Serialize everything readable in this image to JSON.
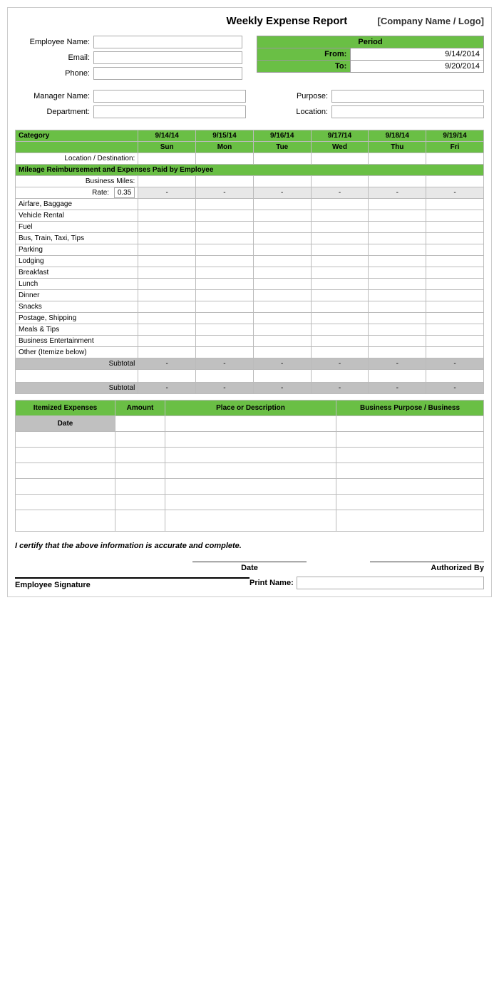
{
  "title": "Weekly Expense Report",
  "company": "[Company Name / Logo]",
  "fields": {
    "employee_name_label": "Employee Name:",
    "email_label": "Email:",
    "phone_label": "Phone:",
    "manager_name_label": "Manager Name:",
    "department_label": "Department:",
    "purpose_label": "Purpose:",
    "location_label": "Location:"
  },
  "period": {
    "header": "Period",
    "from_label": "From:",
    "from_value": "9/14/2014",
    "to_label": "To:",
    "to_value": "9/20/2014"
  },
  "grid": {
    "category_label": "Category",
    "location_destination_label": "Location / Destination:",
    "days": [
      {
        "date": "9/14/14",
        "day": "Sun"
      },
      {
        "date": "9/15/14",
        "day": "Mon"
      },
      {
        "date": "9/16/14",
        "day": "Tue"
      },
      {
        "date": "9/17/14",
        "day": "Wed"
      },
      {
        "date": "9/18/14",
        "day": "Thu"
      },
      {
        "date": "9/19/14",
        "day": "Fri"
      }
    ],
    "mileage_section": "Mileage Reimbursement and Expenses Paid by Employee",
    "business_miles_label": "Business Miles:",
    "rate_label": "Rate:",
    "rate_value": "0.35",
    "dash": "-",
    "categories": [
      "Airfare, Baggage",
      "Vehicle Rental",
      "Fuel",
      "Bus, Train, Taxi, Tips",
      "Parking",
      "Lodging",
      "Breakfast",
      "Lunch",
      "Dinner",
      "Snacks",
      "Postage, Shipping",
      "Meals & Tips",
      "Business Entertainment",
      "Other (Itemize below)"
    ],
    "subtotal_label": "Subtotal"
  },
  "itemized": {
    "header": "Itemized Expenses",
    "amount_label": "Amount",
    "place_label": "Place or Description",
    "purpose_label": "Business Purpose / Business",
    "date_label": "Date",
    "rows": 7
  },
  "certify_text": "I certify that the above information is accurate and complete.",
  "signature": {
    "employee_label": "Employee Signature",
    "date_label": "Date",
    "authorized_label": "Authorized By",
    "print_name_label": "Print Name:"
  }
}
